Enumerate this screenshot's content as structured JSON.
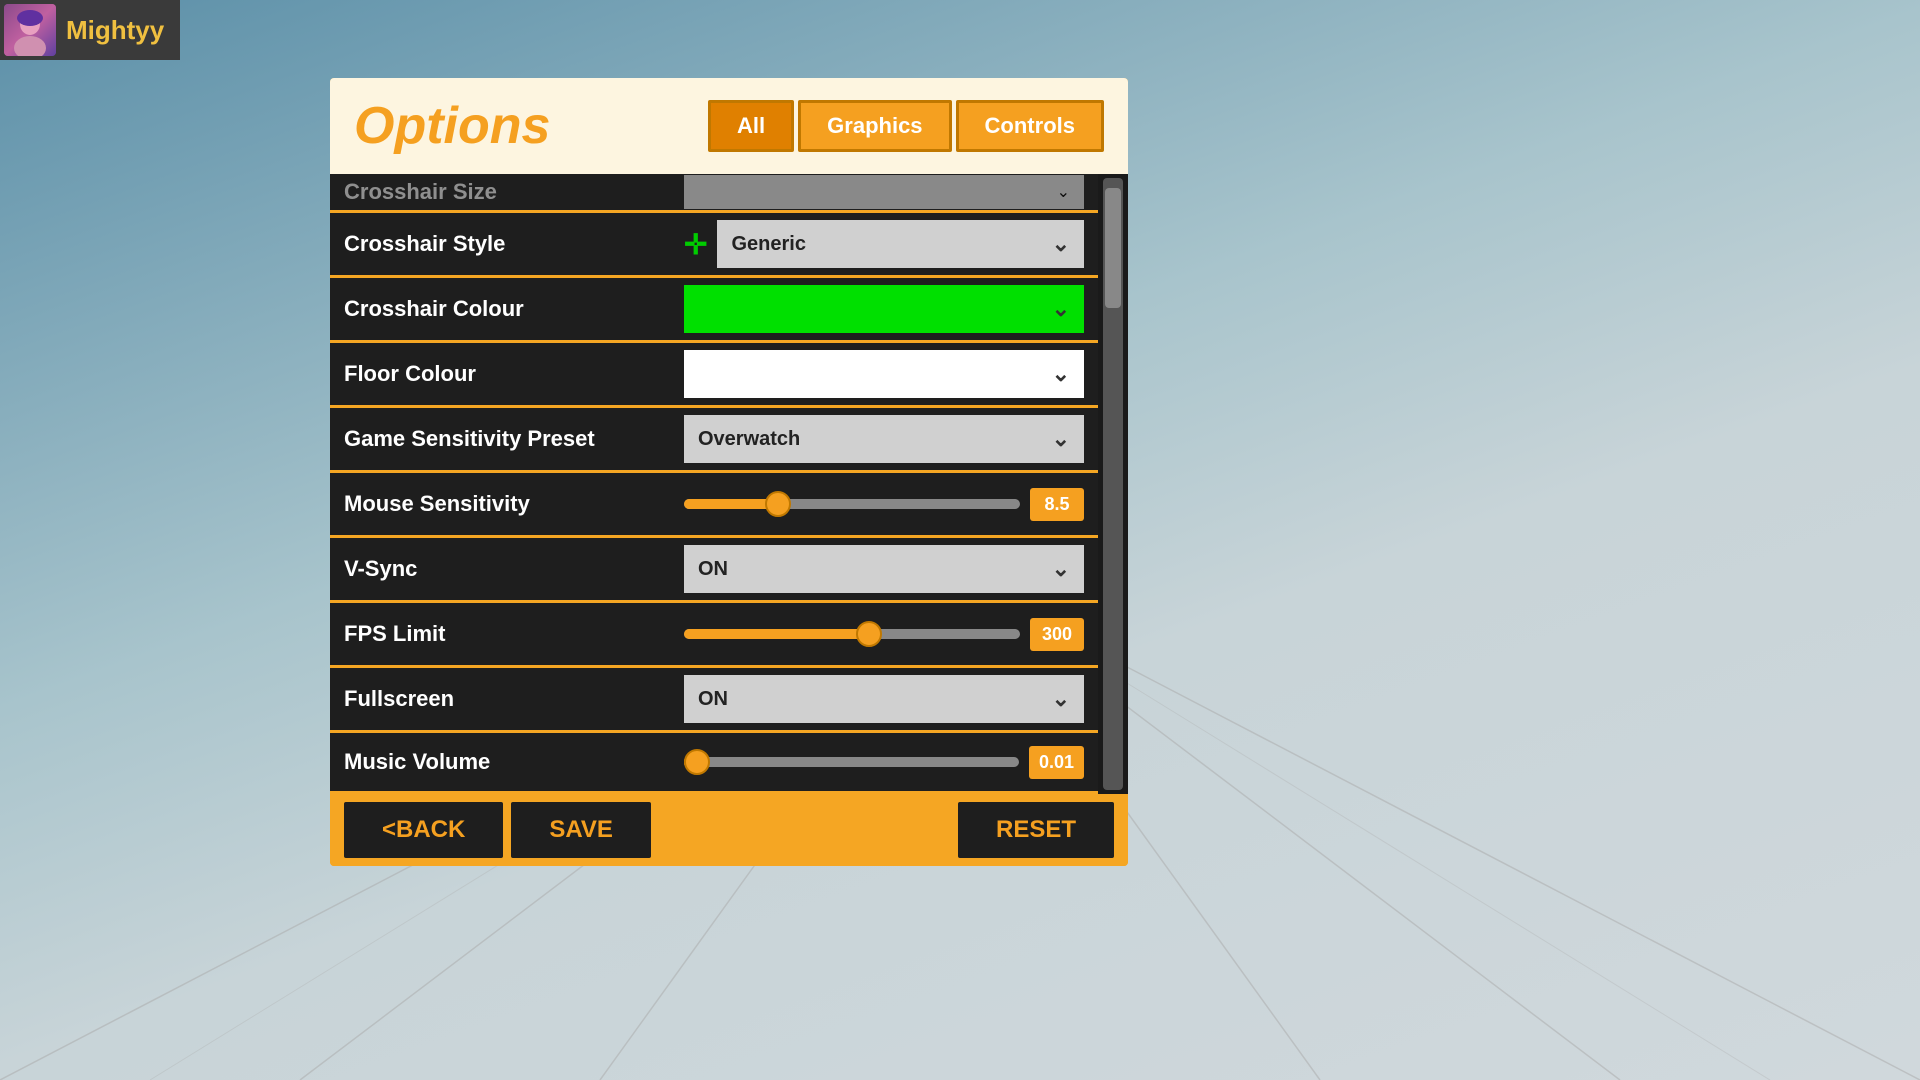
{
  "background": {
    "description": "blue-gray gradient with floor lines"
  },
  "user": {
    "name": "Mightyy",
    "avatar_color1": "#8b4a8b",
    "avatar_color2": "#c060a0"
  },
  "dialog": {
    "title": "Options",
    "tabs": [
      {
        "id": "all",
        "label": "All",
        "active": true
      },
      {
        "id": "graphics",
        "label": "Graphics",
        "active": false
      },
      {
        "id": "controls",
        "label": "Controls",
        "active": false
      }
    ]
  },
  "settings": [
    {
      "id": "crosshair-style",
      "label": "Crosshair Style",
      "type": "dropdown",
      "value": "Generic",
      "bg": "gray"
    },
    {
      "id": "crosshair-colour",
      "label": "Crosshair Colour",
      "type": "dropdown",
      "value": "",
      "bg": "green"
    },
    {
      "id": "floor-colour",
      "label": "Floor Colour",
      "type": "dropdown",
      "value": "",
      "bg": "white"
    },
    {
      "id": "game-sensitivity-preset",
      "label": "Game Sensitivity Preset",
      "type": "dropdown",
      "value": "Overwatch",
      "bg": "gray"
    },
    {
      "id": "mouse-sensitivity",
      "label": "Mouse Sensitivity",
      "type": "slider",
      "value": "8.5",
      "fill_percent": 28
    },
    {
      "id": "v-sync",
      "label": "V-Sync",
      "type": "dropdown",
      "value": "ON",
      "bg": "gray"
    },
    {
      "id": "fps-limit",
      "label": "FPS Limit",
      "type": "slider",
      "value": "300",
      "fill_percent": 55
    },
    {
      "id": "fullscreen",
      "label": "Fullscreen",
      "type": "dropdown",
      "value": "ON",
      "bg": "gray"
    },
    {
      "id": "music-volume",
      "label": "Music Volume",
      "type": "slider",
      "value": "0.01",
      "fill_percent": 2
    }
  ],
  "footer": {
    "back_label": "<BACK",
    "save_label": "SAVE",
    "reset_label": "RESET"
  }
}
